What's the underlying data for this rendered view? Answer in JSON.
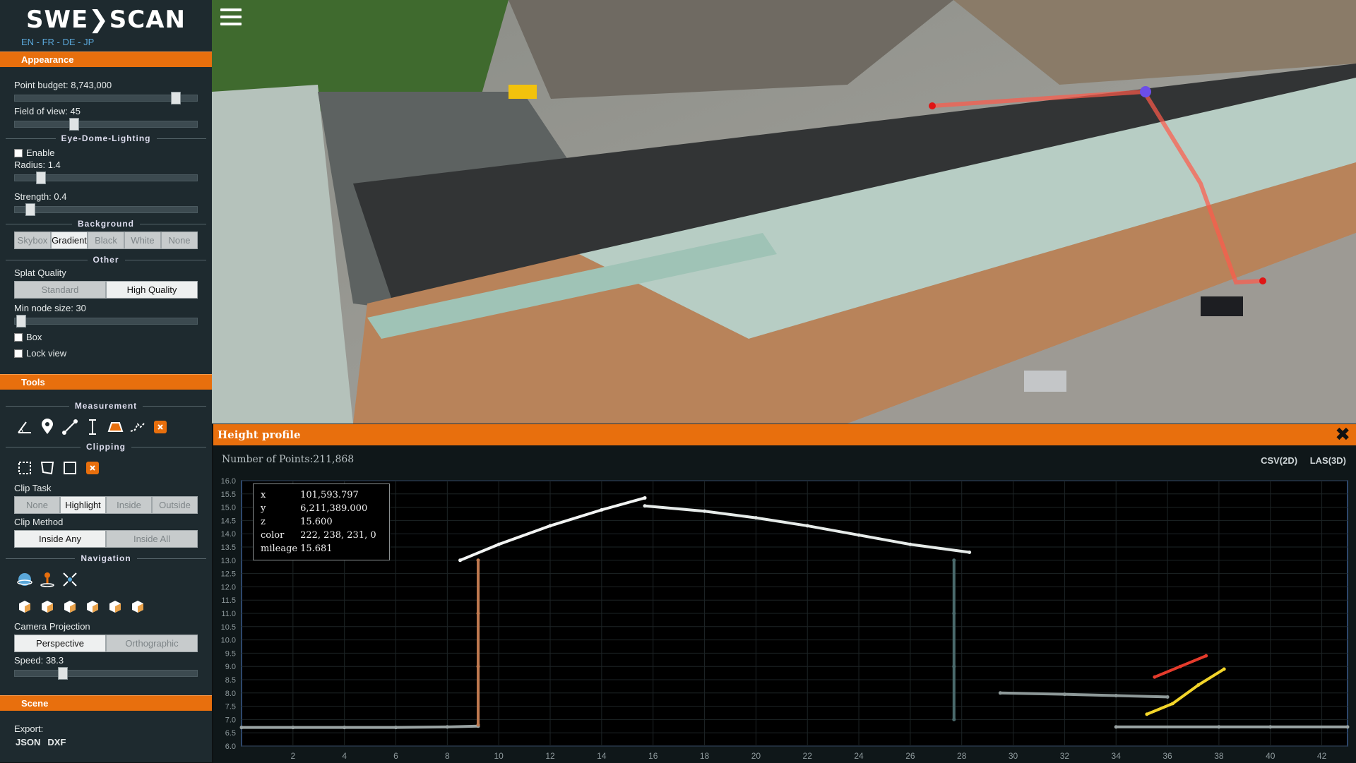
{
  "logo": "SWE❯SCAN",
  "languages": "EN - FR - DE - JP",
  "appearance": {
    "header": "Appearance",
    "point_budget_label": "Point budget: 8,743,000",
    "point_budget_level": 0.88,
    "fov_label": "Field of view: 45",
    "fov_level": 0.32,
    "edl_title": "Eye-Dome-Lighting",
    "edl_enable": "Enable",
    "edl_radius": "Radius: 1.4",
    "edl_radius_level": 0.14,
    "edl_strength": "Strength: 0.4",
    "edl_strength_level": 0.08,
    "background_title": "Background",
    "background_options": [
      "Skybox",
      "Gradient",
      "Black",
      "White",
      "None"
    ],
    "background_selected": "Gradient",
    "other_title": "Other",
    "splat_label": "Splat Quality",
    "splat_options": [
      "Standard",
      "High Quality"
    ],
    "splat_selected": "High Quality",
    "min_node_label": "Min node size: 30",
    "min_node_level": 0.03,
    "box_label": "Box",
    "lock_label": "Lock view"
  },
  "tools": {
    "header": "Tools",
    "measurement_title": "Measurement",
    "measurement_icons": [
      "angle-icon",
      "point-icon",
      "distance-icon",
      "height-icon",
      "area-icon",
      "profile-icon",
      "remove-measurements-icon"
    ],
    "clipping_title": "Clipping",
    "clipping_icons": [
      "clip-volume-icon",
      "clip-polygon-icon",
      "clip-plane-icon",
      "remove-clipping-icon"
    ],
    "clip_task_label": "Clip Task",
    "clip_task_options": [
      "None",
      "Highlight",
      "Inside",
      "Outside"
    ],
    "clip_task_selected": "Highlight",
    "clip_method_label": "Clip Method",
    "clip_method_options": [
      "Inside Any",
      "Inside All"
    ],
    "clip_method_selected": "Inside Any",
    "navigation_title": "Navigation",
    "navigation_icons": [
      "earth-controls-icon",
      "fps-controls-icon",
      "orbit-controls-icon"
    ],
    "view_icons": [
      "left-view-icon",
      "front-view-icon",
      "top-view-icon",
      "bottom-view-icon",
      "right-view-icon",
      "back-view-icon"
    ],
    "projection_label": "Camera Projection",
    "projection_options": [
      "Perspective",
      "Orthographic"
    ],
    "projection_selected": "Perspective",
    "speed_label": "Speed: 38.3",
    "speed_level": 0.26
  },
  "scene": {
    "header": "Scene",
    "export_label": "Export:",
    "export_options": [
      "JSON",
      "DXF"
    ]
  },
  "profile": {
    "title": "Height profile",
    "close": "✖",
    "points_label": "Number of Points:211,868",
    "csv": "CSV(2D)",
    "las": "LAS(3D)",
    "tooltip": [
      {
        "k": "x",
        "v": "101,593.797"
      },
      {
        "k": "y",
        "v": "6,211,389.000"
      },
      {
        "k": "z",
        "v": "15.600"
      },
      {
        "k": "color",
        "v": "222, 238, 231, 0"
      },
      {
        "k": "mileage",
        "v": "15.681"
      }
    ]
  },
  "chart_data": {
    "type": "scatter",
    "title": "",
    "xlabel": "",
    "ylabel": "",
    "xlim": [
      0,
      43
    ],
    "ylim": [
      6.0,
      16.0
    ],
    "x_ticks": [
      2,
      4,
      6,
      8,
      10,
      12,
      14,
      16,
      18,
      20,
      22,
      24,
      26,
      28,
      30,
      32,
      34,
      36,
      38,
      40,
      42
    ],
    "y_ticks": [
      6.0,
      6.5,
      7.0,
      7.5,
      8.0,
      8.5,
      9.0,
      9.5,
      10.0,
      10.5,
      11.0,
      11.5,
      12.0,
      12.5,
      13.0,
      13.5,
      14.0,
      14.5,
      15.0,
      15.5,
      16.0
    ],
    "grid": true,
    "series": [
      {
        "color": "#9aa3a3",
        "x": [
          0,
          2,
          4,
          6,
          8,
          9.2
        ],
        "y": [
          6.7,
          6.7,
          6.7,
          6.7,
          6.72,
          6.75
        ]
      },
      {
        "color": "#c07a50",
        "x": [
          9.2,
          9.2,
          9.2,
          9.2
        ],
        "y": [
          6.8,
          9.0,
          11.0,
          13.0
        ]
      },
      {
        "color": "#f2f4f3",
        "x": [
          8.5,
          10,
          12,
          14,
          15.68
        ],
        "y": [
          13.0,
          13.6,
          14.3,
          14.9,
          15.35
        ]
      },
      {
        "color": "#e6ebe9",
        "x": [
          15.68,
          18,
          20,
          22,
          24,
          26,
          28.3
        ],
        "y": [
          15.05,
          14.85,
          14.6,
          14.3,
          13.95,
          13.6,
          13.3
        ]
      },
      {
        "color": "#4a6a6c",
        "x": [
          27.7,
          27.7,
          27.7,
          27.7
        ],
        "y": [
          7.0,
          9.0,
          11.0,
          13.0
        ]
      },
      {
        "color": "#8d9898",
        "x": [
          29.5,
          32,
          34,
          36
        ],
        "y": [
          8.0,
          7.95,
          7.9,
          7.85
        ]
      },
      {
        "color": "#9aa3a3",
        "x": [
          34,
          38,
          40,
          43
        ],
        "y": [
          6.72,
          6.72,
          6.72,
          6.72
        ]
      },
      {
        "color": "#e53b2c",
        "x": [
          35.5,
          36.5,
          37.5
        ],
        "y": [
          8.6,
          9.0,
          9.4
        ]
      },
      {
        "color": "#f3d52a",
        "x": [
          35.2,
          36.2,
          37.2,
          38.2
        ],
        "y": [
          7.2,
          7.6,
          8.3,
          8.9
        ]
      }
    ]
  }
}
